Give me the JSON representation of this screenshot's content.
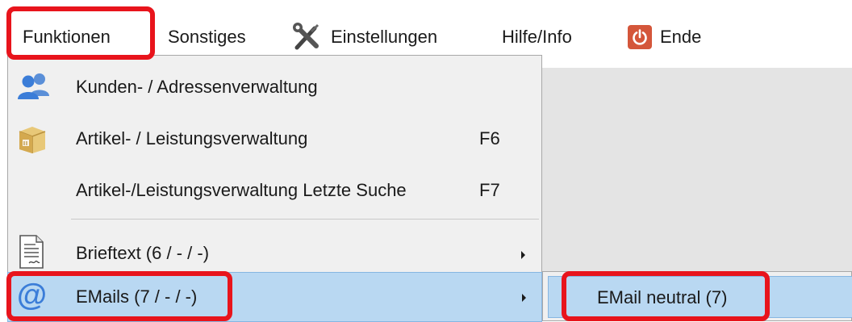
{
  "menubar": {
    "funktionen": "Funktionen",
    "sonstiges": "Sonstiges",
    "einstellungen": "Einstellungen",
    "hilfe": "Hilfe/Info",
    "ende": "Ende"
  },
  "dropdown": {
    "items": [
      {
        "label": "Kunden- / Adressenverwaltung",
        "icon": "users-icon"
      },
      {
        "label": "Artikel- / Leistungsverwaltung",
        "shortcut": "F6",
        "icon": "box-icon"
      },
      {
        "label": "Artikel-/Leistungsverwaltung Letzte Suche",
        "shortcut": "F7"
      },
      {
        "label": "Brieftext (6 / - / -)",
        "icon": "document-icon",
        "has_submenu": true
      },
      {
        "label": "EMails (7 / - / -)",
        "icon": "at-sign-icon",
        "has_submenu": true,
        "highlighted": true
      }
    ]
  },
  "submenu": {
    "items": [
      {
        "label": "EMail neutral (7)",
        "highlighted": true
      }
    ]
  },
  "colors": {
    "highlight_bg": "#b9d8f2",
    "annotation_red": "#e8141c",
    "power_button": "#d4563a",
    "icon_blue": "#3b7dd8"
  }
}
